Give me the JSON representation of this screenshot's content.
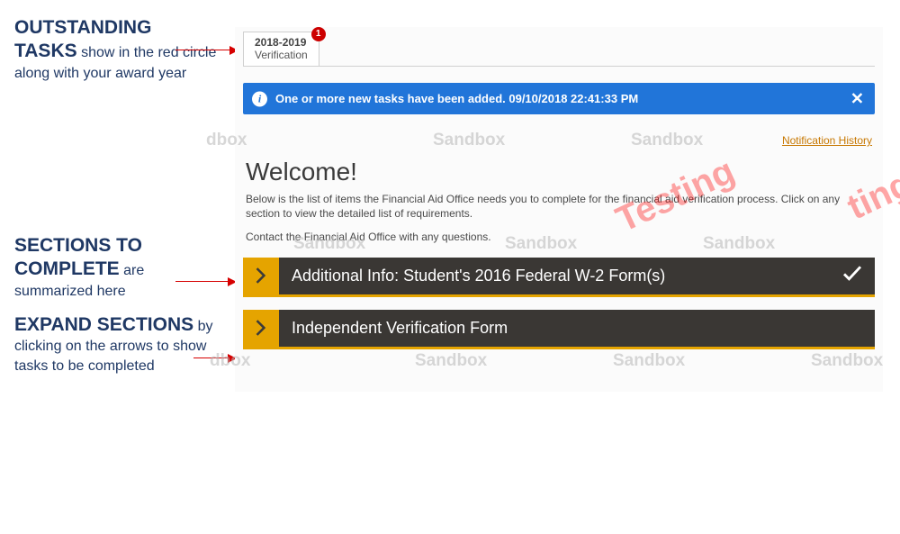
{
  "annotations": {
    "a1_title": "OUTSTANDING TASKS",
    "a1_text": " show in the red circle along with your award year",
    "a2_title": "SECTIONS TO COMPLETE",
    "a2_text": " are summarized here",
    "a3_title": "EXPAND SECTIONS",
    "a3_text": " by clicking on the arrows to show tasks to be completed"
  },
  "tab": {
    "year": "2018-2019",
    "label": "Verification",
    "badge": "1"
  },
  "banner": {
    "text": "One or more new tasks have been added. 09/10/2018 22:41:33 PM"
  },
  "links": {
    "notification_history": "Notification History"
  },
  "welcome": {
    "heading": "Welcome!",
    "p1": "Below is the list of items the Financial Aid Office needs you to complete for the financial aid verification process. Click on any section to view the detailed list of requirements.",
    "p2": "Contact the Financial Aid Office with any questions."
  },
  "sections": [
    {
      "title": "Additional Info: Student's 2016 Federal W-2 Form(s)",
      "completed": true
    },
    {
      "title": "Independent Verification Form",
      "completed": false
    }
  ],
  "watermarks": {
    "sandbox": "Sandbox",
    "sandbox_cut": "dbox",
    "testing": "Testing",
    "testing_cut": "ting"
  }
}
